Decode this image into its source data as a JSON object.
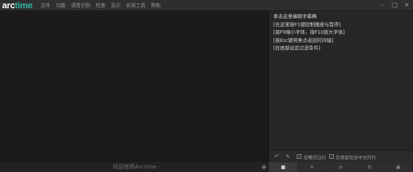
{
  "app": {
    "logo_prefix": "arc",
    "logo_suffix": "time"
  },
  "menu": [
    "文件",
    "功能",
    "语音识别",
    "检查",
    "显示",
    "实用工具",
    "帮助"
  ],
  "editor": {
    "text": "单击这里编辑字幕稿\n[在这里按F1键控制播放与暂停]\n[按F9缩小字体，按F10放大字体]\n[按Esc键将焦点返回时间轴]\n[在底部设定过滤条件]"
  },
  "toolbar": {
    "filter_empty_label": "忽略空白行",
    "only_chinese_label": "仅保留包含中文的行"
  },
  "status": {
    "welcome": "欢迎使用Arctime"
  },
  "colors": {
    "brand_accent": "#2fb3a0",
    "background": "#1f1f1f"
  }
}
